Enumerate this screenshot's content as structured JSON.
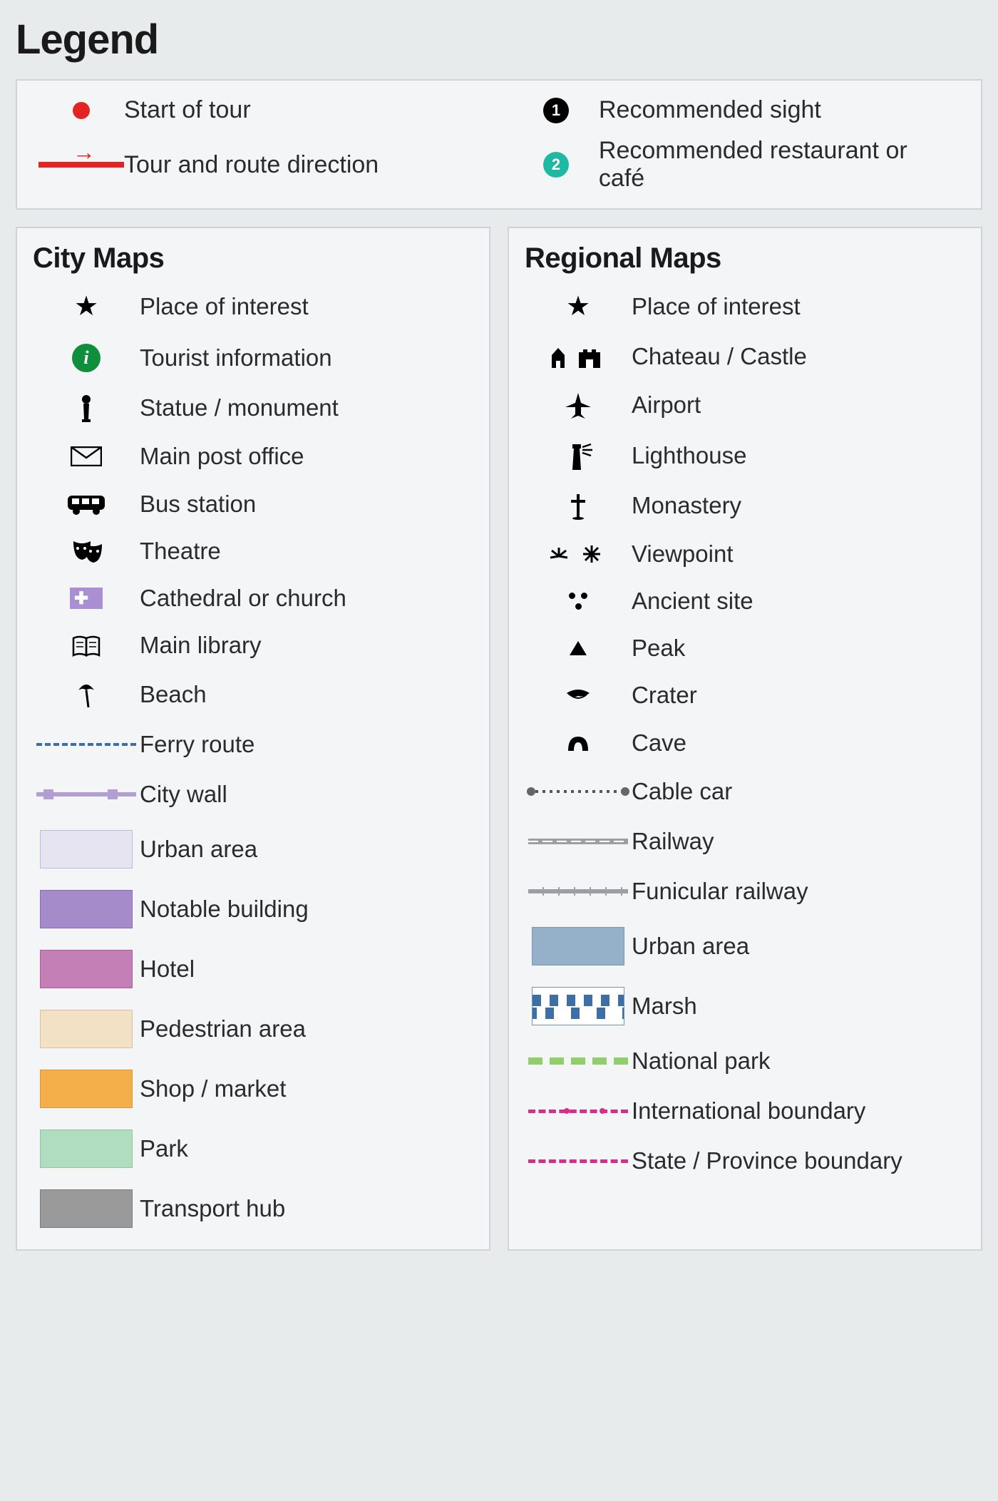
{
  "title": "Legend",
  "top": {
    "start_of_tour": "Start of tour",
    "tour_direction": "Tour and route direction",
    "rec_sight": "Recommended sight",
    "rec_restaurant": "Recommended restaurant or café",
    "num1": "1",
    "num2": "2"
  },
  "city": {
    "heading": "City Maps",
    "items": {
      "place_of_interest": "Place of interest",
      "tourist_info": "Tourist information",
      "statue": "Statue / monument",
      "post_office": "Main post office",
      "bus_station": "Bus station",
      "theatre": "Theatre",
      "church": "Cathedral or church",
      "library": "Main library",
      "beach": "Beach",
      "ferry": "Ferry route",
      "city_wall": "City wall",
      "urban_area": "Urban area",
      "notable_building": "Notable building",
      "hotel": "Hotel",
      "pedestrian_area": "Pedestrian area",
      "shop_market": "Shop / market",
      "park": "Park",
      "transport_hub": "Transport hub"
    }
  },
  "regional": {
    "heading": "Regional Maps",
    "items": {
      "place_of_interest": "Place of interest",
      "chateau": "Chateau / Castle",
      "airport": "Airport",
      "lighthouse": "Lighthouse",
      "monastery": "Monastery",
      "viewpoint": "Viewpoint",
      "ancient_site": "Ancient site",
      "peak": "Peak",
      "crater": "Crater",
      "cave": "Cave",
      "cable_car": "Cable car",
      "railway": "Railway",
      "funicular": "Funicular railway",
      "urban_area": "Urban area",
      "marsh": "Marsh",
      "national_park": "National park",
      "intl_boundary": "International boundary",
      "state_boundary": "State / Province boundary"
    }
  }
}
